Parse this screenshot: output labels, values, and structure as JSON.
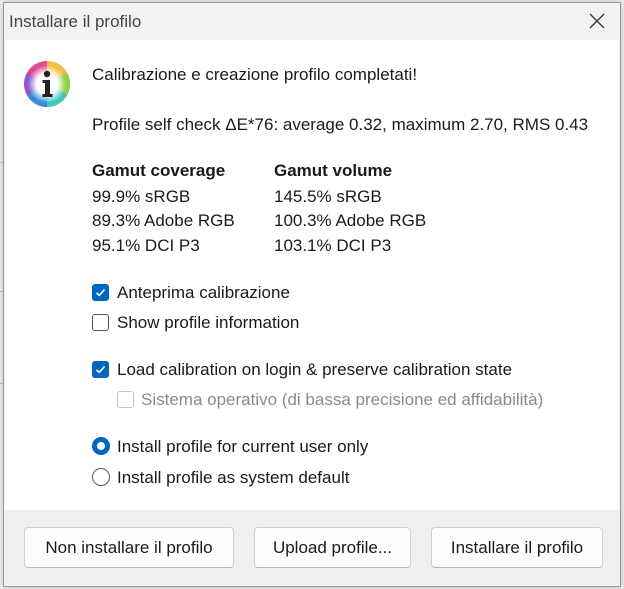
{
  "dialog": {
    "title": "Installare il profilo",
    "heading": "Calibrazione e creazione profilo completati!",
    "self_check": "Profile self check ΔE*76: average 0.32, maximum 2.70, RMS 0.43",
    "gamut": {
      "coverage_header": "Gamut coverage",
      "volume_header": "Gamut volume",
      "coverage": [
        "99.9% sRGB",
        "89.3% Adobe RGB",
        "95.1% DCI P3"
      ],
      "volume": [
        "145.5% sRGB",
        "100.3% Adobe RGB",
        "103.1% DCI P3"
      ]
    },
    "options": {
      "preview_calibration": {
        "label": "Anteprima calibrazione",
        "checked": true
      },
      "show_profile_info": {
        "label": "Show profile information",
        "checked": false
      },
      "load_calibration": {
        "label": "Load calibration on login & preserve calibration state",
        "checked": true
      },
      "os_loader": {
        "label": "Sistema operativo (di bassa precisione ed affidabilità)",
        "checked": false,
        "disabled": true
      }
    },
    "install_scope": {
      "current_user": {
        "label": "Install profile for current user only",
        "selected": true
      },
      "system_default": {
        "label": "Install profile as system default",
        "selected": false
      }
    },
    "buttons": {
      "dont_install": "Non installare il profilo",
      "upload": "Upload profile...",
      "install": "Installare il profilo"
    },
    "colors": {
      "accent": "#0067c0",
      "content_bg": "#ffffff",
      "footer_bg": "#f0f0f0"
    }
  }
}
